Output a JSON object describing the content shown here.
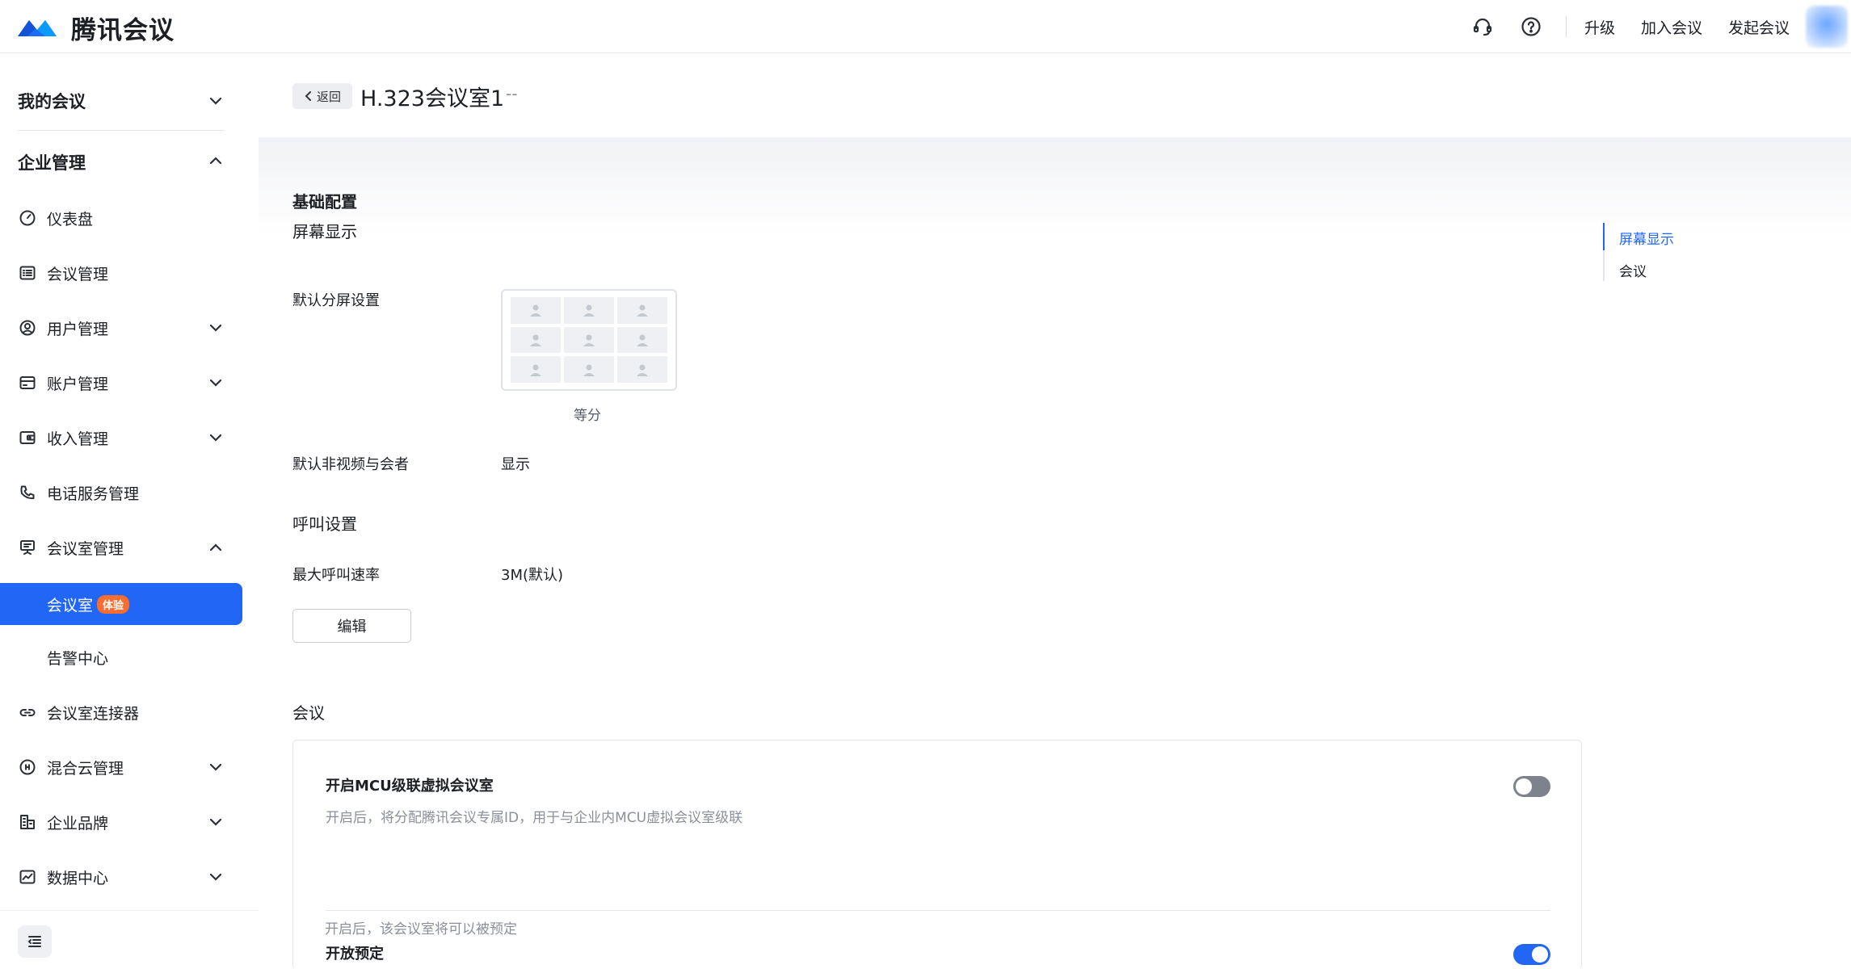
{
  "app": {
    "name": "腾讯会议"
  },
  "topbar": {
    "upgrade": "升级",
    "join": "加入会议",
    "start": "发起会议"
  },
  "sidebar": {
    "my_meetings": "我的会议",
    "enterprise": "企业管理",
    "items": [
      {
        "label": "仪表盘"
      },
      {
        "label": "会议管理"
      },
      {
        "label": "用户管理"
      },
      {
        "label": "账户管理"
      },
      {
        "label": "收入管理"
      },
      {
        "label": "电话服务管理"
      },
      {
        "label": "会议室管理"
      },
      {
        "label": "会议室",
        "badge": "体验"
      },
      {
        "label": "告警中心"
      },
      {
        "label": "会议室连接器"
      },
      {
        "label": "混合云管理"
      },
      {
        "label": "企业品牌"
      },
      {
        "label": "数据中心"
      }
    ]
  },
  "page": {
    "back": "返回",
    "title": "H.323会议室1",
    "title_suffix": "--",
    "basic_config": "基础配置",
    "screen_display": "屏幕显示",
    "default_split_label": "默认分屏设置",
    "default_split_value": "等分",
    "non_video_label": "默认非视频与会者",
    "non_video_value": "显示",
    "call_settings": "呼叫设置",
    "max_call_rate_label": "最大呼叫速率",
    "max_call_rate_value": "3M(默认)",
    "edit": "编辑",
    "meeting_section": "会议",
    "mcu_title": "开启MCU级联虚拟会议室",
    "mcu_desc": "开启后，将分配腾讯会议专属ID，用于与企业内MCU虚拟会议室级联",
    "mcu_enabled": false,
    "booking_title": "开放预定",
    "booking_desc": "开启后，该会议室将可以被预定",
    "booking_enabled": true
  },
  "anchor_nav": {
    "items": [
      "屏幕显示",
      "会议"
    ],
    "active": "屏幕显示"
  },
  "colors": {
    "accent": "#2166f5",
    "badge": "#f96d30"
  }
}
